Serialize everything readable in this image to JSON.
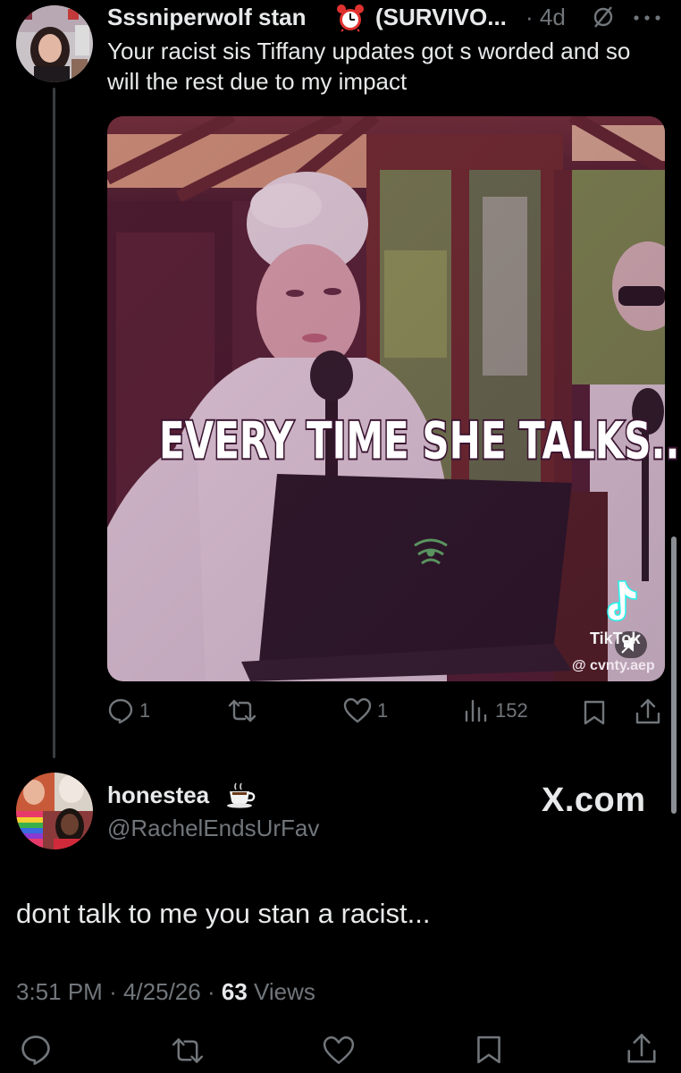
{
  "reply_tweet": {
    "display_name": "Sssniperwolf stan",
    "name_suffix": "(SURVIVO...",
    "time": "· 4d",
    "text": "Your racist sis Tiffany updates got s worded and so will the rest due to my impact",
    "media": {
      "caption": "EVERY TIME SHE TALKS...",
      "tiktok_label": "TikTok",
      "tiktok_handle": "@ cvnty.aep"
    },
    "actions": {
      "replies": "1",
      "reposts": "",
      "likes": "1",
      "views": "152"
    }
  },
  "main_tweet": {
    "display_name": "honestea",
    "handle": "@RachelEndsUrFav",
    "badge": "X.com",
    "text": "dont talk to me you stan a racist...",
    "time": "3:51 PM",
    "date": "4/25/26",
    "views_count": "63",
    "views_label": "Views"
  },
  "icons": {
    "alarm": "alarm-clock-icon",
    "muted": "muted-icon",
    "more": "more-icon",
    "reply": "reply-icon",
    "repost": "repost-icon",
    "like": "like-icon",
    "views": "views-icon",
    "bookmark": "bookmark-icon",
    "share": "share-icon",
    "coffee": "coffee-icon"
  },
  "colors": {
    "background": "#000000",
    "text": "#e7e9ea",
    "muted": "#71767b",
    "alarm": "#e0322f"
  }
}
